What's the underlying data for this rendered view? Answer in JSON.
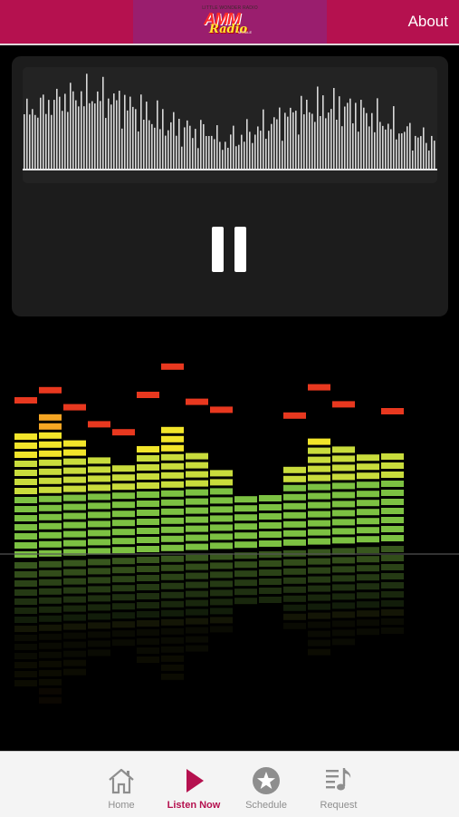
{
  "header": {
    "logo_tagline": "LITTLE WONDER RADIO",
    "logo_line1": "AMM",
    "logo_line2": "Radio",
    "logo_sub": "MOBILE",
    "about_label": "About"
  },
  "player": {
    "state": "playing",
    "control_icon": "pause-icon"
  },
  "tabs": [
    {
      "label": "Home",
      "icon": "home-icon",
      "active": false
    },
    {
      "label": "Listen Now",
      "icon": "play-icon",
      "active": true
    },
    {
      "label": "Schedule",
      "icon": "star-icon",
      "active": false
    },
    {
      "label": "Request",
      "icon": "music-list-icon",
      "active": false
    }
  ],
  "colors": {
    "brand": "#b5114f",
    "logo_bg": "#9a1e6e",
    "tab_active": "#b5114f",
    "tab_inactive": "#8e8e8e"
  }
}
